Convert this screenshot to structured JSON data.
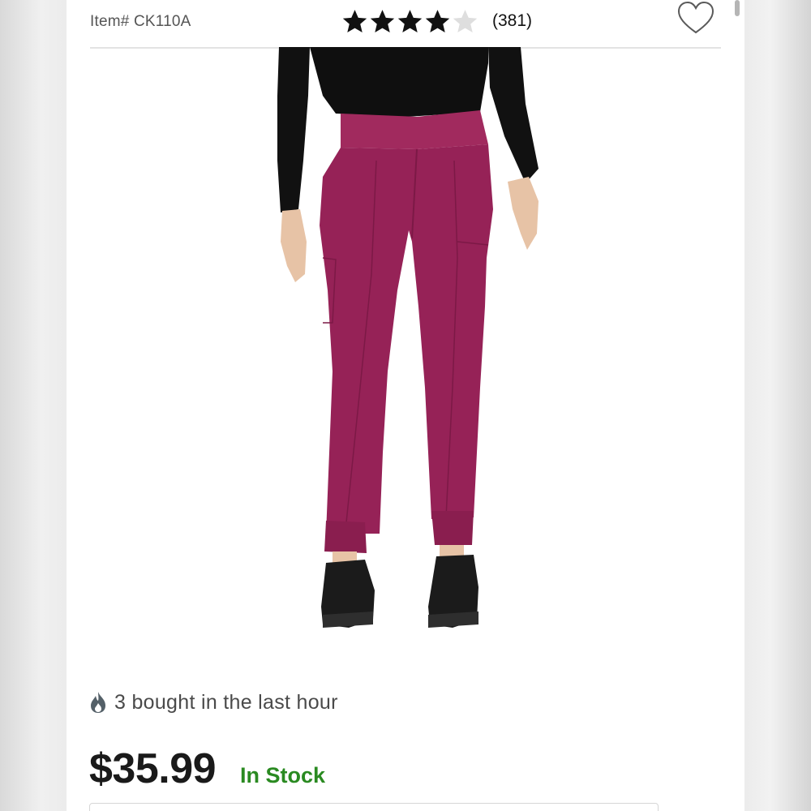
{
  "header": {
    "item_number": "Item# CK110A",
    "rating": 4,
    "max_rating": 5,
    "review_count": "(381)",
    "favorite_icon": "heart-outline-icon",
    "star_icon": "star-icon"
  },
  "product": {
    "image_alt": "Woman wearing wine-colored jogger scrub pants with black top and black sneakers",
    "pants_color": "#9a2358",
    "top_color": "#111111"
  },
  "urgency": {
    "icon": "flame-icon",
    "text": "3 bought in the last hour"
  },
  "pricing": {
    "price": "$35.99",
    "stock_status": "In Stock",
    "stock_color": "#2a8a21"
  }
}
